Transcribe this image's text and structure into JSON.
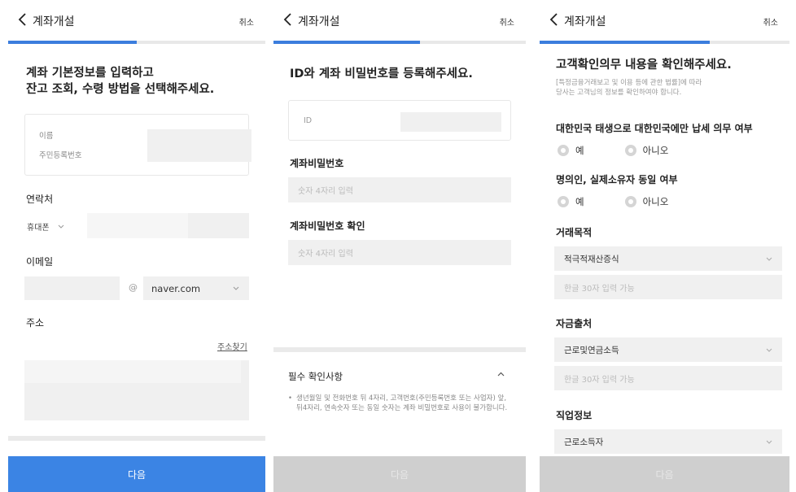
{
  "screen1": {
    "header": {
      "title": "계좌개설",
      "cancel": "취소"
    },
    "progress_fraction": 0.5,
    "heading_line1": "계좌 기본정보를 입력하고",
    "heading_line2": "잔고 조회, 수령 방법을 선택해주세요.",
    "name_label": "이름",
    "rrn_label": "주민등록번호",
    "contact_label": "연락처",
    "phone_type": "휴대폰",
    "email_label": "이메일",
    "at_sign": "@",
    "email_domain": "naver.com",
    "address_label": "주소",
    "address_find": "주소찾기",
    "next": "다음"
  },
  "screen2": {
    "header": {
      "title": "계좌개설",
      "cancel": "취소"
    },
    "progress_fraction": 0.58,
    "heading": "ID와 계좌 비밀번호를 등록해주세요.",
    "id_label": "ID",
    "password_label": "계좌비밀번호",
    "password_placeholder": "숫자 4자리 입력",
    "password_confirm_label": "계좌비밀번호 확인",
    "password_confirm_placeholder": "숫자 4자리 입력",
    "notice_title": "필수 확인사항",
    "notice_bullet": "•",
    "notice_text": "생년월일 및 전화번호 뒤 4자리, 고객번호(주민등록번호 또는 사업자) 앞, 뒤4자리, 연속숫자 또는 동일 숫자는 계좌 비밀번호로 사용이 불가합니다.",
    "next": "다음"
  },
  "screen3": {
    "header": {
      "title": "계좌개설",
      "cancel": "취소"
    },
    "progress_fraction": 0.68,
    "heading": "고객확인의무 내용을 확인해주세요.",
    "sub_line1": "[특정금융거래보고 및 이용 등에 관한 법률]에 따라",
    "sub_line2": "당사는 고객님의 정보를 확인하여야 합니다.",
    "q1": "대한민국 태생으로 대한민국에만 납세 의무 여부",
    "q2": "명의인, 실제소유자 동일 여부",
    "yes": "예",
    "no": "아니오",
    "purpose_label": "거래목적",
    "purpose_value": "적극적재산증식",
    "purpose_placeholder": "한글 30자 입력 가능",
    "source_label": "자금출처",
    "source_value": "근로및연금소득",
    "source_placeholder": "한글 30자 입력 가능",
    "job_label": "직업정보",
    "job_value": "근로소득자",
    "next": "다음"
  }
}
